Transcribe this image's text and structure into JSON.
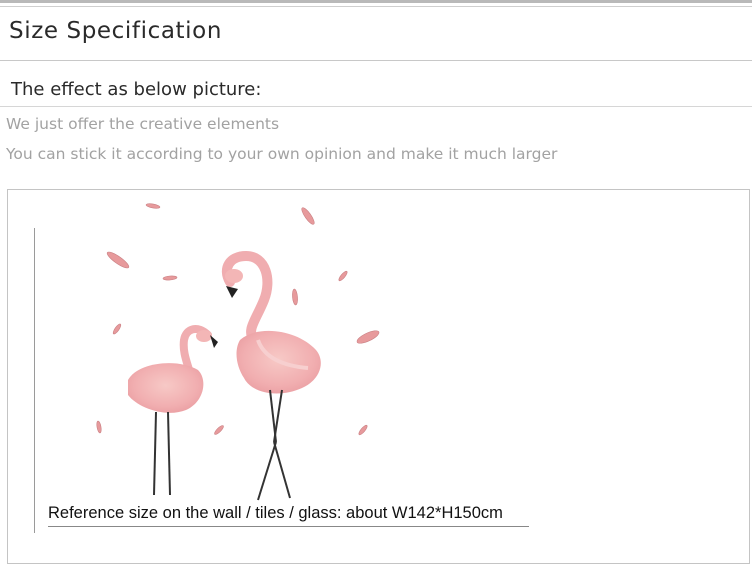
{
  "header": {
    "title": "Size Specification"
  },
  "effect": {
    "label": "The effect as below picture:"
  },
  "notes": [
    "We just offer the creative elements",
    "You can stick it according to your own opinion and make it much larger"
  ],
  "picture": {
    "caption": "Reference size on the wall / tiles / glass: about W142*H150cm"
  },
  "colors": {
    "flamingo_pink": "#f2b3b3",
    "feather_pink": "#e79a9c",
    "rule_gray": "#c8c8c8",
    "note_gray": "#a2a2a2"
  }
}
